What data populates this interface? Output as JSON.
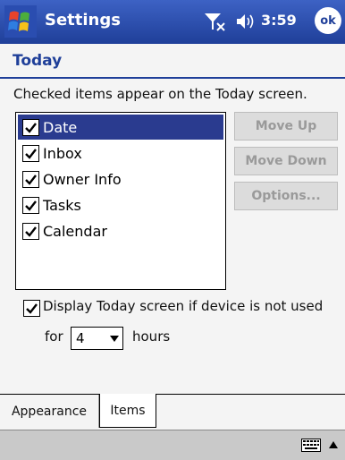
{
  "titlebar": {
    "title": "Settings",
    "clock": "3:59",
    "ok_label": "ok",
    "icons": [
      "windows-start-icon",
      "signal-icon",
      "volume-icon"
    ]
  },
  "page": {
    "title": "Today",
    "instruction": "Checked items appear on the Today screen."
  },
  "list": {
    "items": [
      {
        "label": "Date",
        "checked": true,
        "selected": true
      },
      {
        "label": "Inbox",
        "checked": true,
        "selected": false
      },
      {
        "label": "Owner Info",
        "checked": true,
        "selected": false
      },
      {
        "label": "Tasks",
        "checked": true,
        "selected": false
      },
      {
        "label": "Calendar",
        "checked": true,
        "selected": false
      }
    ]
  },
  "buttons": {
    "move_up": "Move Up",
    "move_down": "Move Down",
    "options": "Options..."
  },
  "display_today": {
    "label": "Display Today screen if device is not used",
    "checked": true,
    "for_label": "for",
    "hours_value": "4",
    "hours_label": "hours"
  },
  "tabs": [
    {
      "label": "Appearance",
      "active": false
    },
    {
      "label": "Items",
      "active": true
    }
  ],
  "colors": {
    "titlebar": "#2a4db0",
    "accent": "#1f3f99",
    "selection": "#2a3b8f",
    "disabled_button": "#dcdcdc"
  }
}
